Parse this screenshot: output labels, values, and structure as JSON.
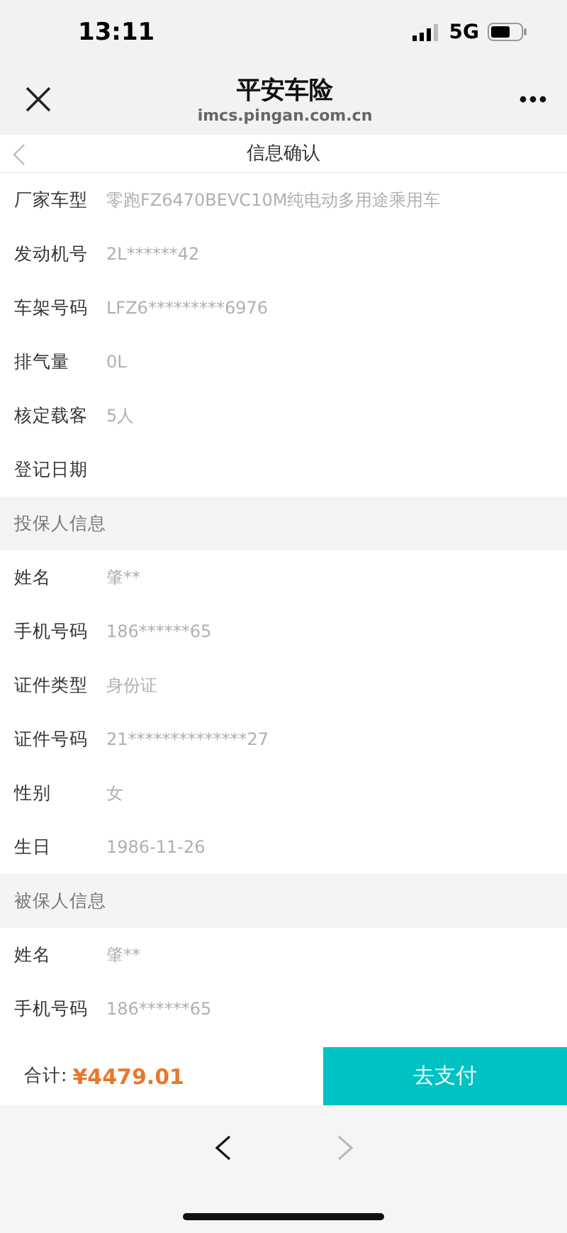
{
  "status_bar": {
    "time": "13:11",
    "network": "5G"
  },
  "browser_bar": {
    "title": "平安车险",
    "url": "imcs.pingan.com.cn"
  },
  "page_header": {
    "title": "信息确认"
  },
  "sections": [
    {
      "rows": [
        {
          "label": "厂家车型",
          "value": "零跑FZ6470BEVC10M纯电动多用途乘用车"
        },
        {
          "label": "发动机号",
          "value": "2L******42"
        },
        {
          "label": "车架号码",
          "value": "LFZ6*********6976"
        },
        {
          "label": "排气量",
          "value": "0L"
        },
        {
          "label": "核定载客",
          "value": "5人"
        },
        {
          "label": "登记日期"
        }
      ]
    },
    {
      "title": "投保人信息",
      "rows": [
        {
          "label": "姓名",
          "value": "肇**"
        },
        {
          "label": "手机号码",
          "value": "186******65"
        },
        {
          "label": "证件类型",
          "value": "身份证"
        },
        {
          "label": "证件号码",
          "value": "21**************27"
        },
        {
          "label": "性别",
          "value": "女"
        },
        {
          "label": "生日",
          "value": "1986-11-26"
        }
      ]
    },
    {
      "title": "被保人信息",
      "rows": [
        {
          "label": "姓名",
          "value": "肇**"
        },
        {
          "label": "手机号码",
          "value": "186******65"
        }
      ]
    }
  ],
  "footer": {
    "total_label": "合计:",
    "total": "¥4479.01",
    "pay_button": "去支付"
  },
  "browser_nav": {
    "back_disabled": false,
    "forward_disabled": true
  }
}
